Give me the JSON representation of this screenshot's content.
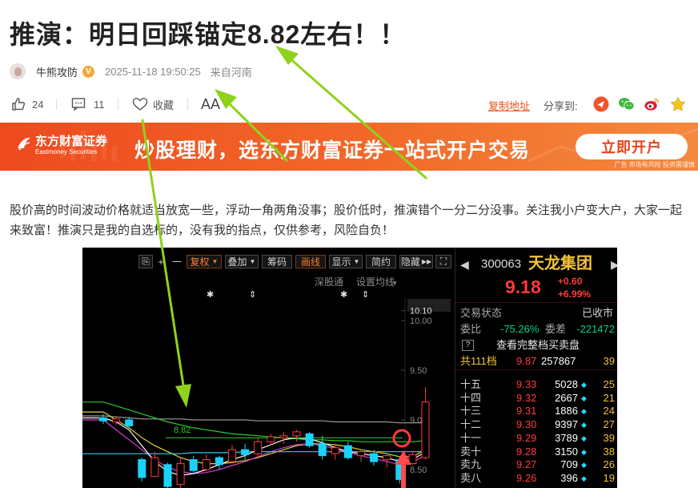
{
  "article": {
    "title": "推演：明日回踩锚定8.82左右！！",
    "author": "牛熊攻防",
    "verified_badge": "V",
    "time": "2025-11-18 19:50:25",
    "location": "来自河南",
    "likes": "24",
    "comments": "11",
    "collect_label": "收藏",
    "font_label": "AA",
    "copy_link_label": "复制地址",
    "share_label": "分享到:",
    "share_icons": [
      "share-arrow-icon",
      "wechat-icon",
      "weibo-icon",
      "star-icon"
    ],
    "body": "股价高的时间波动价格就适当放宽一些，浮动一角两角没事；股价低时，推演错个一分二分没事。关注我小户变大户，大家一起来致富！推演只是我的自选标的，没有我的指点，仅供参考，风险自负！"
  },
  "banner": {
    "logo_cn": "东方财富证券",
    "logo_en": "Eastmoney Securities",
    "slogan": "炒股理财，选东方财富证券一站式开户交易",
    "button": "立即开户",
    "note": "广告 市场有风险 投资需谨慎",
    "colors": {
      "start": "#ee4a1f",
      "end": "#f3893f",
      "button_text": "#e8431d"
    }
  },
  "chart": {
    "toolbar": {
      "restore": "⎘",
      "plus": "+",
      "minus": "一",
      "adjust": "复权",
      "overlay": "叠加",
      "chips": "筹码",
      "draw": "画线",
      "display": "显示",
      "simple": "简约",
      "hide": "隐藏",
      "expand": "⛶"
    },
    "labels": {
      "hk_connect": "深股通",
      "ma_setting": "设置均线",
      "level": "8.82"
    },
    "price_axis": [
      "10.10",
      "10.00",
      "9.50",
      "9.00",
      "8.50"
    ],
    "chart_data": {
      "type": "candlestick",
      "ylim": [
        8.4,
        10.15
      ],
      "level_line": 8.82,
      "candles": [
        {
          "o": 9.02,
          "h": 9.06,
          "l": 8.96,
          "c": 8.99
        },
        {
          "o": 8.98,
          "h": 9.04,
          "l": 8.95,
          "c": 9.01
        },
        {
          "o": 9.0,
          "h": 9.03,
          "l": 8.93,
          "c": 8.94
        },
        {
          "o": 8.6,
          "h": 8.62,
          "l": 8.38,
          "c": 8.42
        },
        {
          "o": 8.43,
          "h": 8.68,
          "l": 8.42,
          "c": 8.62
        },
        {
          "o": 8.55,
          "h": 8.57,
          "l": 8.3,
          "c": 8.33
        },
        {
          "o": 8.35,
          "h": 8.62,
          "l": 8.3,
          "c": 8.56
        },
        {
          "o": 8.6,
          "h": 8.64,
          "l": 8.46,
          "c": 8.49
        },
        {
          "o": 8.5,
          "h": 8.65,
          "l": 8.48,
          "c": 8.6
        },
        {
          "o": 8.62,
          "h": 8.64,
          "l": 8.5,
          "c": 8.55
        },
        {
          "o": 8.58,
          "h": 8.75,
          "l": 8.56,
          "c": 8.7
        },
        {
          "o": 8.7,
          "h": 8.76,
          "l": 8.6,
          "c": 8.65
        },
        {
          "o": 8.66,
          "h": 8.82,
          "l": 8.64,
          "c": 8.78
        },
        {
          "o": 8.78,
          "h": 8.86,
          "l": 8.74,
          "c": 8.83
        },
        {
          "o": 8.82,
          "h": 8.88,
          "l": 8.76,
          "c": 8.84
        },
        {
          "o": 8.84,
          "h": 8.9,
          "l": 8.78,
          "c": 8.88
        },
        {
          "o": 8.86,
          "h": 8.88,
          "l": 8.72,
          "c": 8.74
        },
        {
          "o": 8.76,
          "h": 8.84,
          "l": 8.6,
          "c": 8.64
        },
        {
          "o": 8.66,
          "h": 8.76,
          "l": 8.6,
          "c": 8.72
        },
        {
          "o": 8.74,
          "h": 8.78,
          "l": 8.6,
          "c": 8.62
        },
        {
          "o": 8.64,
          "h": 8.7,
          "l": 8.58,
          "c": 8.68
        },
        {
          "o": 8.66,
          "h": 8.7,
          "l": 8.54,
          "c": 8.58
        },
        {
          "o": 8.6,
          "h": 8.66,
          "l": 8.52,
          "c": 8.64
        },
        {
          "o": 8.6,
          "h": 8.62,
          "l": 8.36,
          "c": 8.4
        },
        {
          "o": 8.56,
          "h": 8.68,
          "l": 8.55,
          "c": 8.65
        },
        {
          "o": 8.62,
          "h": 9.33,
          "l": 8.6,
          "c": 9.18
        }
      ],
      "moving_averages": [
        {
          "color": "#9a9a9a",
          "values": [
            9.04,
            9.03,
            9.02,
            9.01,
            9.01,
            9.01,
            9.01,
            9.0,
            9.0,
            9.0,
            9.0,
            9.0,
            8.99,
            8.99,
            8.99,
            8.99,
            8.99,
            8.99,
            8.98,
            8.98,
            8.98,
            8.98,
            8.98,
            8.97,
            8.97,
            8.97
          ]
        },
        {
          "color": "#2fc72f",
          "values": [
            9.18,
            9.14,
            9.1,
            9.06,
            9.02,
            8.98,
            8.95,
            8.92,
            8.9,
            8.88,
            8.86,
            8.85,
            8.84,
            8.83,
            8.82,
            8.81,
            8.8,
            8.8,
            8.79,
            8.79,
            8.78,
            8.78,
            8.78,
            8.78,
            8.78,
            8.79
          ]
        },
        {
          "color": "#d9d933",
          "values": [
            9.08,
            9.0,
            8.92,
            8.82,
            8.74,
            8.68,
            8.62,
            8.58,
            8.56,
            8.56,
            8.57,
            8.59,
            8.62,
            8.66,
            8.7,
            8.74,
            8.76,
            8.76,
            8.75,
            8.73,
            8.7,
            8.68,
            8.66,
            8.63,
            8.63,
            8.7
          ]
        },
        {
          "color": "#d23fd2",
          "values": [
            9.0,
            8.9,
            8.8,
            8.7,
            8.6,
            8.52,
            8.48,
            8.46,
            8.47,
            8.5,
            8.54,
            8.58,
            8.63,
            8.68,
            8.72,
            8.75,
            8.76,
            8.74,
            8.71,
            8.67,
            8.64,
            8.61,
            8.58,
            8.55,
            8.58,
            8.64
          ]
        },
        {
          "color": "#3cc9f0",
          "values": [
            8.66,
            8.66,
            8.66,
            8.66,
            8.66,
            8.66,
            8.66,
            8.67,
            8.67,
            8.67,
            8.67,
            8.68,
            8.68,
            8.68,
            8.68,
            8.68,
            8.68,
            8.68,
            8.68,
            8.68,
            8.68,
            8.68,
            8.68,
            8.68,
            8.68,
            8.68
          ]
        },
        {
          "color": "#ffffff",
          "values": [
            9.02,
            8.98,
            8.9,
            8.74,
            8.58,
            8.48,
            8.44,
            8.46,
            8.5,
            8.55,
            8.6,
            8.64,
            8.7,
            8.75,
            8.8,
            8.82,
            8.81,
            8.77,
            8.72,
            8.68,
            8.66,
            8.64,
            8.62,
            8.58,
            8.6,
            8.68
          ]
        }
      ]
    }
  },
  "quote": {
    "code": "300063",
    "name": "天龙集团",
    "price": "9.18",
    "change": "+0.60",
    "change_pct": "+6.99%",
    "status_label": "交易状态",
    "status_value": "已收市",
    "wb_label": "委比",
    "wb_value": "-75.26%",
    "wc_label": "委差",
    "wc_value": "-221472",
    "full_book": "查看完整档买卖盘",
    "total_label": "共111档",
    "total_price": "9.87",
    "total_volume": "257867",
    "total_count": "39",
    "book": [
      {
        "level": "十五",
        "price": "9.33",
        "volume": "5028",
        "count": "25"
      },
      {
        "level": "十四",
        "price": "9.32",
        "volume": "2667",
        "count": "21"
      },
      {
        "level": "十三",
        "price": "9.31",
        "volume": "1886",
        "count": "24"
      },
      {
        "level": "十二",
        "price": "9.30",
        "volume": "9397",
        "count": "27"
      },
      {
        "level": "十一",
        "price": "9.29",
        "volume": "3789",
        "count": "39"
      },
      {
        "level": "卖十",
        "price": "9.28",
        "volume": "3150",
        "count": "38"
      },
      {
        "level": "卖九",
        "price": "9.27",
        "volume": "709",
        "count": "26"
      },
      {
        "level": "卖八",
        "price": "9.26",
        "volume": "396",
        "count": "19"
      }
    ]
  }
}
